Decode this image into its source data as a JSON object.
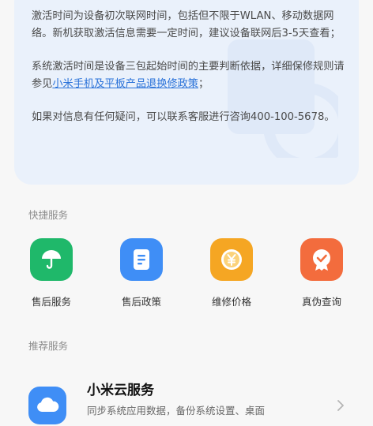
{
  "info_card": {
    "paragraph_1": "激活时间为设备初次联网时间，包括但不限于WLAN、移动数据网络。新机获取激活信息需要一定时间，建议设备联网后3-5天查看；",
    "paragraph_2_prefix": "系统激活时间是设备三包起始时间的主要判断依据，详细保修规则请参见",
    "paragraph_2_link": "小米手机及平板产品退换修政策",
    "paragraph_2_suffix": "；",
    "paragraph_3": "如果对信息有任何疑问，可以联系客服进行咨询400-100-5678。"
  },
  "quick_services": {
    "title": "快捷服务",
    "items": [
      {
        "label": "售后服务",
        "icon": "umbrella-icon",
        "color": "#1fb86a"
      },
      {
        "label": "售后政策",
        "icon": "document-icon",
        "color": "#3f8ef6"
      },
      {
        "label": "维修价格",
        "icon": "yuan-coin-icon",
        "color": "#f5a623"
      },
      {
        "label": "真伪查询",
        "icon": "badge-check-icon",
        "color": "#f36c3d"
      }
    ]
  },
  "recommended": {
    "title": "推荐服务",
    "item": {
      "title": "小米云服务",
      "desc": "同步系统应用数据，备份系统设置、桌面",
      "icon": "cloud-icon",
      "color": "#3f8ef6"
    }
  }
}
